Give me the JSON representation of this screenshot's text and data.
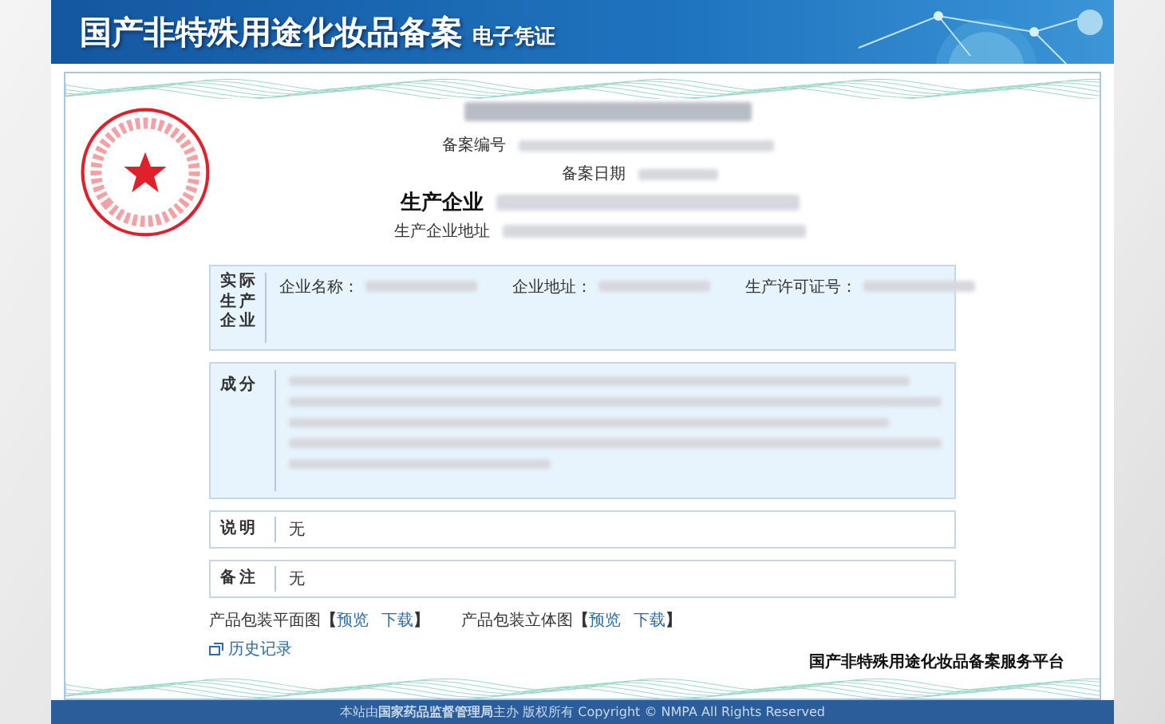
{
  "header": {
    "title": "国产非特殊用途化妆品备案",
    "subtitle": "电子凭证"
  },
  "certificate": {
    "record_number_label": "备案编号",
    "record_date_label": "备案日期",
    "producer_label": "生产企业",
    "producer_address_label": "生产企业地址",
    "actual_producer": {
      "label": "实际生产企业",
      "fields": [
        "企业名称：",
        "企业地址：",
        "生产许可证号："
      ]
    },
    "ingredients": {
      "label": "成分"
    },
    "rows": [
      {
        "label": "说明",
        "value": "无"
      },
      {
        "label": "备注",
        "value": "无"
      }
    ],
    "packages": [
      {
        "label": "产品包装平面图",
        "open": "【",
        "links": [
          "预览",
          "下载"
        ],
        "close": "】"
      },
      {
        "label": "产品包装立体图",
        "open": "【",
        "links": [
          "预览",
          "下载"
        ],
        "close": "】"
      }
    ],
    "history_link": "历史记录",
    "platform": "国产非特殊用途化妆品备案服务平台"
  },
  "footer": "本站由**国家药品监督管理局**主办 版权所有 Copyright © NMPA All Rights Reserved"
}
